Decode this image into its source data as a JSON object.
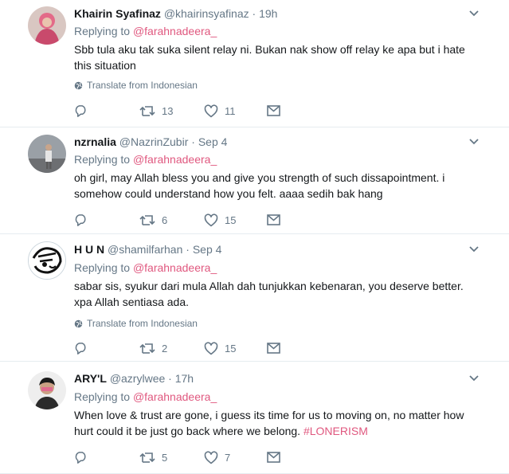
{
  "tweets": [
    {
      "name": "Khairin Syafinaz",
      "handle": "@khairinsyafinaz",
      "sep": "·",
      "time": "19h",
      "replying_prefix": "Replying to ",
      "replying_to": "@farahnadeera_",
      "text": "Sbb tula aku tak suka silent relay ni. Bukan nak show off relay ke apa but i hate this situation",
      "translate": "Translate from Indonesian",
      "reply_count": "",
      "retweet_count": "13",
      "like_count": "11"
    },
    {
      "name": "nzrnalia",
      "handle": "@NazrinZubir",
      "sep": "·",
      "time": "Sep 4",
      "replying_prefix": "Replying to ",
      "replying_to": "@farahnadeera_",
      "text": "oh girl, may Allah bless you and give you strength of such dissapointment. i somehow could understand how you felt. aaaa sedih bak hang",
      "reply_count": "",
      "retweet_count": "6",
      "like_count": "15"
    },
    {
      "name": "H U N",
      "handle": "@shamilfarhan",
      "sep": "·",
      "time": "Sep 4",
      "replying_prefix": "Replying to ",
      "replying_to": "@farahnadeera_",
      "text": "sabar sis, syukur dari mula Allah dah tunjukkan kebenaran, you deserve better. xpa Allah sentiasa ada.",
      "translate": "Translate from Indonesian",
      "reply_count": "",
      "retweet_count": "2",
      "like_count": "15"
    },
    {
      "name": "ARY'L",
      "handle": "@azrylwee",
      "sep": "·",
      "time": "17h",
      "replying_prefix": "Replying to ",
      "replying_to": "@farahnadeera_",
      "text": "When love & trust are gone, i guess its time for us to moving on, no matter how hurt could it be just go back where we belong. ",
      "hashtag": "#LONERISM",
      "reply_count": "",
      "retweet_count": "5",
      "like_count": "7"
    }
  ],
  "colors": {
    "accent": "#e0587f",
    "muted": "#657786",
    "border": "#e6ecf0"
  },
  "icons": [
    "reply-icon",
    "retweet-icon",
    "like-icon",
    "message-icon",
    "globe-icon",
    "chevron-down-icon"
  ]
}
